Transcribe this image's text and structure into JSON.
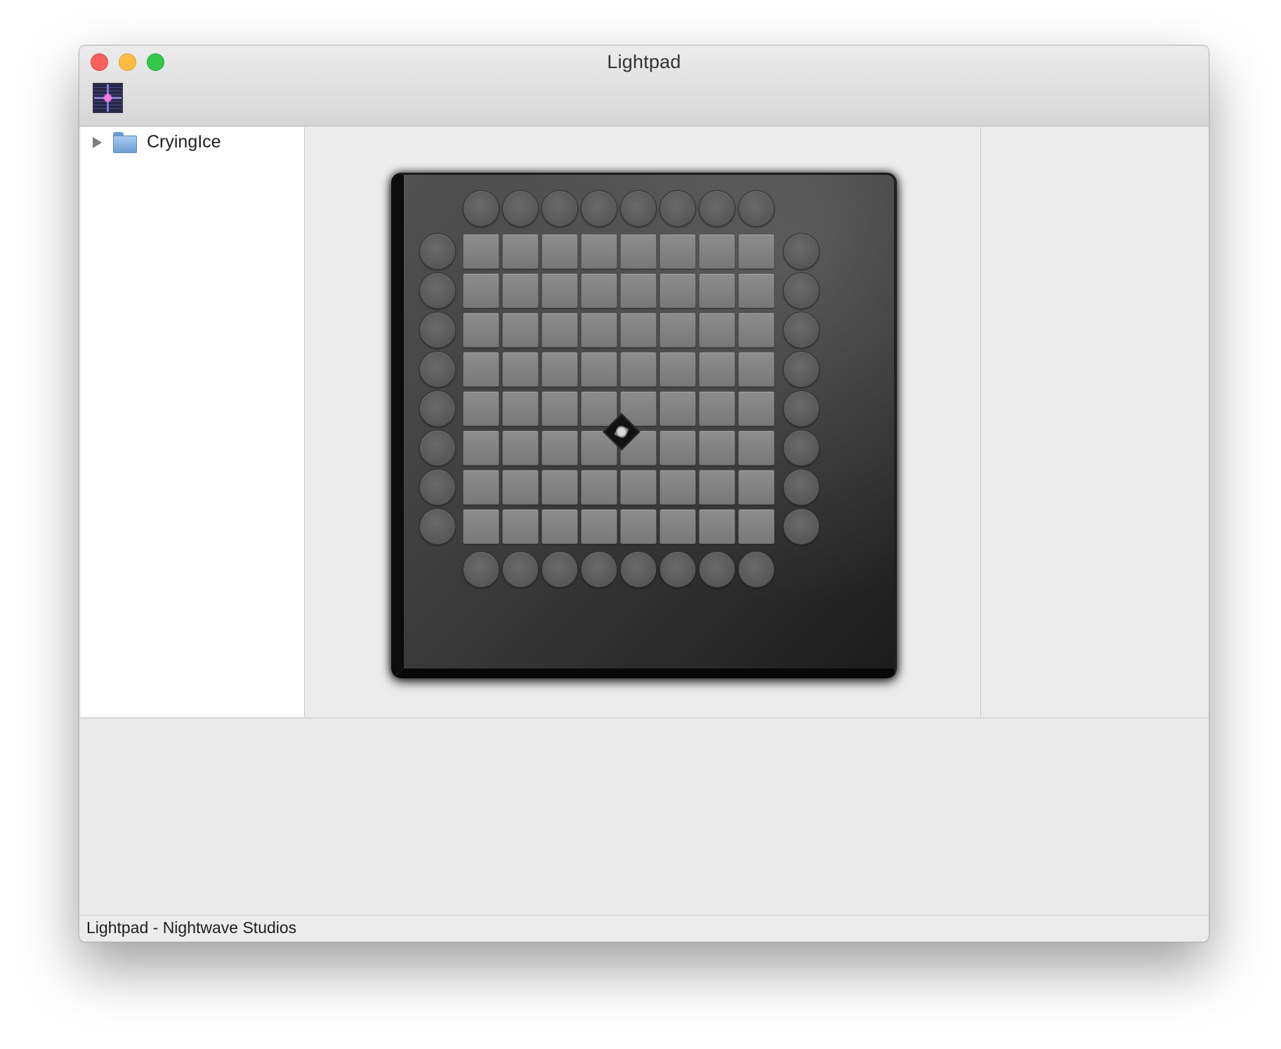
{
  "window": {
    "title": "Lightpad",
    "toolbar_icon": "app-grid-icon"
  },
  "tree": {
    "items": [
      {
        "label": "CryingIce",
        "icon": "folder-icon",
        "expanded": false
      }
    ]
  },
  "device": {
    "grid_rows": 8,
    "grid_cols": 8,
    "top_buttons": 8,
    "bottom_buttons": 8,
    "left_buttons": 8,
    "right_buttons": 8,
    "pad_color": "#808080",
    "round_color": "#5e5e5e",
    "logo_icon": "brand-logo-icon"
  },
  "status": {
    "text": "Lightpad - Nightwave Studios"
  }
}
